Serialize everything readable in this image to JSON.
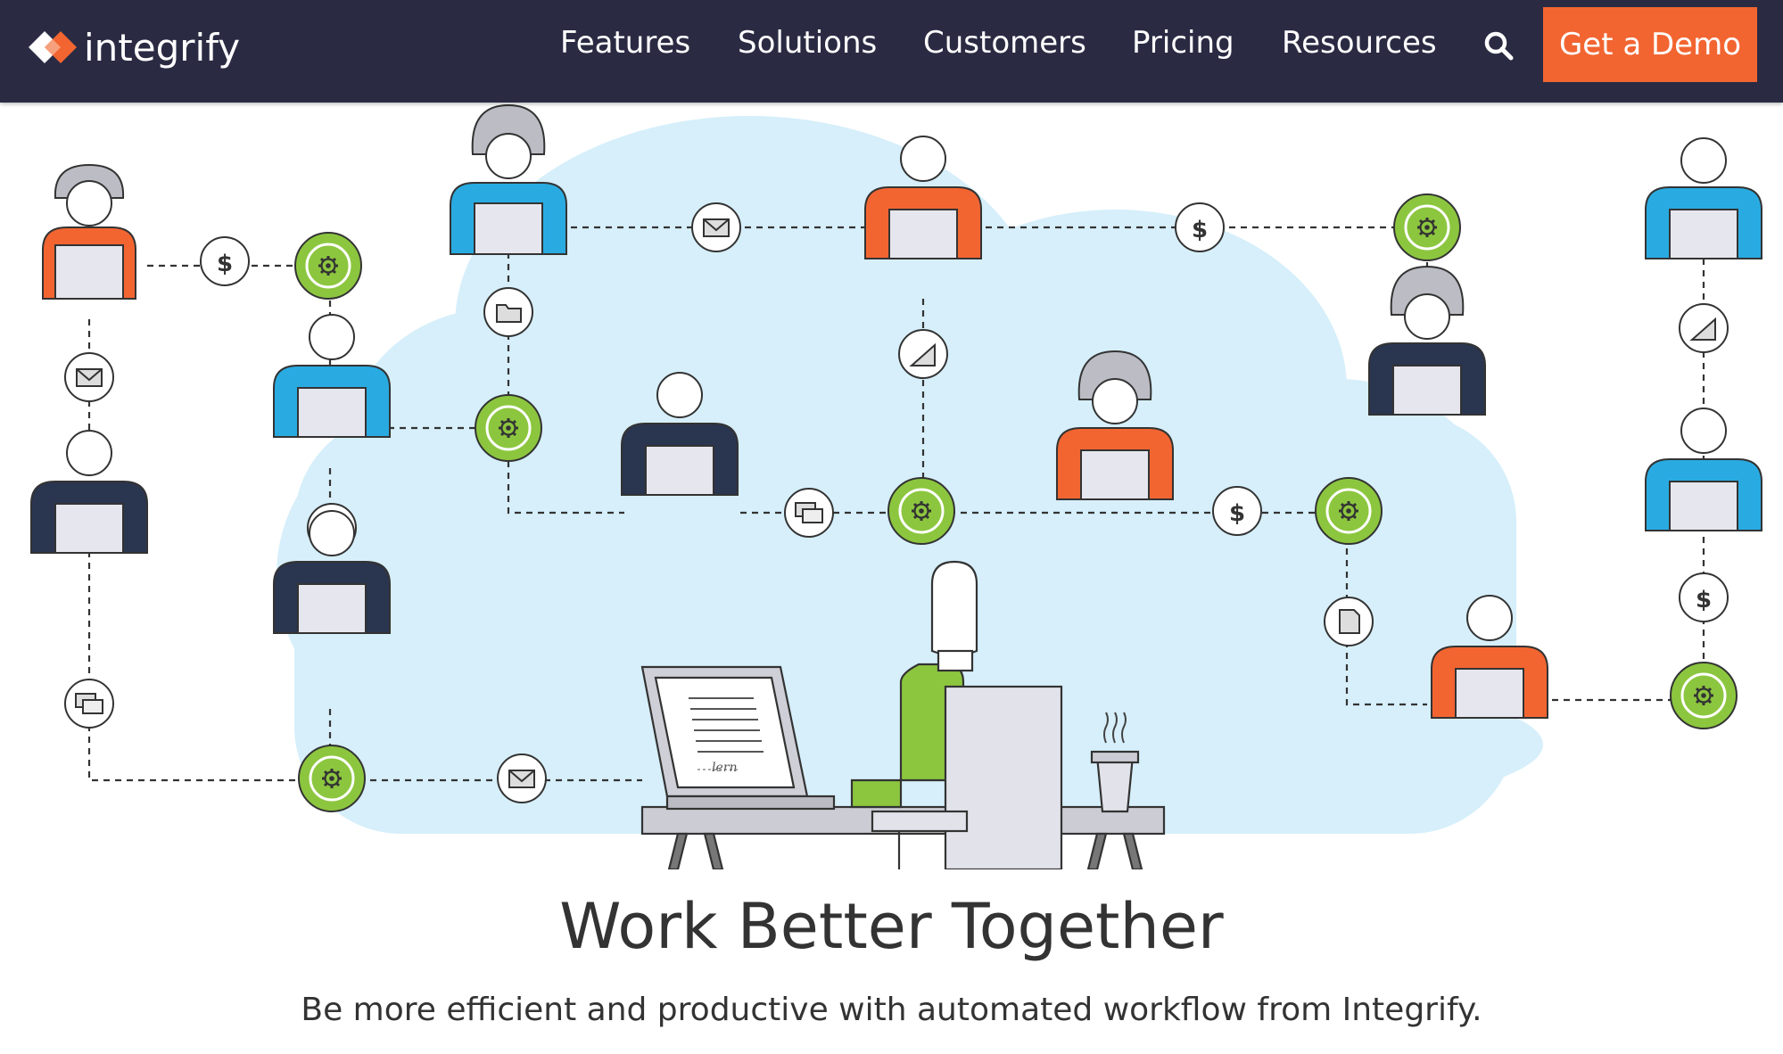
{
  "brand": {
    "name": "integrify"
  },
  "nav": {
    "items": [
      {
        "label": "Features"
      },
      {
        "label": "Solutions"
      },
      {
        "label": "Customers"
      },
      {
        "label": "Pricing"
      },
      {
        "label": "Resources"
      }
    ],
    "search_icon": "search-icon",
    "cta_label": "Get a Demo"
  },
  "hero": {
    "title": "Work Better Together",
    "subtitle": "Be more efficient and productive with automated workflow from Integrify.",
    "document_signature": "lern"
  },
  "colors": {
    "nav_bg": "#2a2b43",
    "cta": "#f26531",
    "cloud": "#d6effa",
    "orange": "#f26531",
    "blue": "#29abe2",
    "navy": "#2a3550",
    "green": "#8cc63f"
  }
}
